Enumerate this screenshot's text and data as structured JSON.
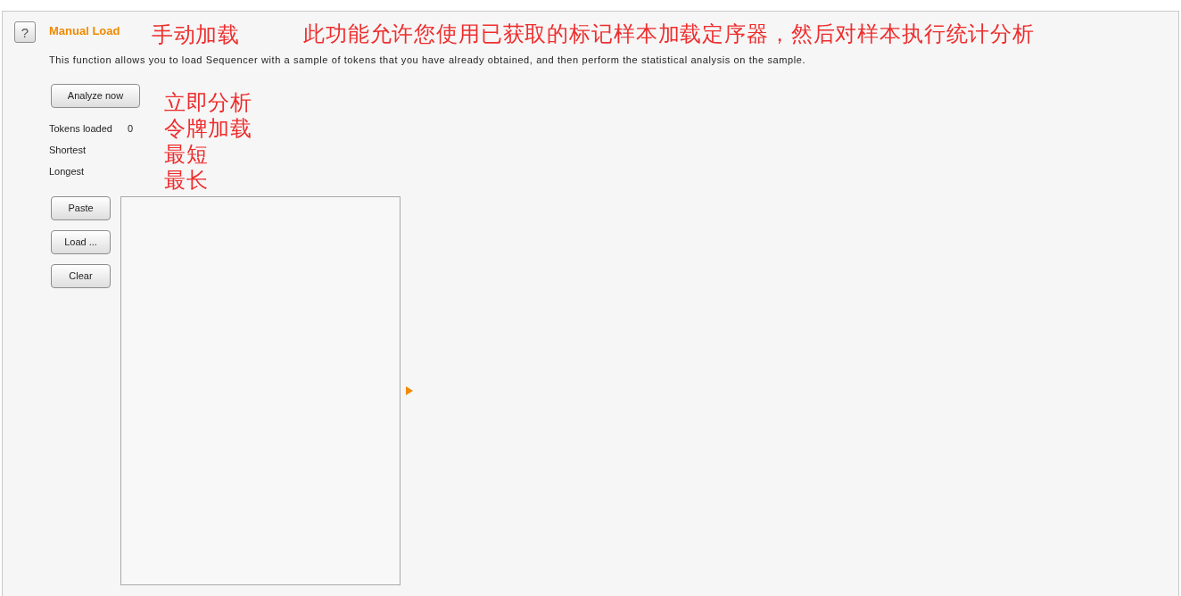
{
  "help_button": {
    "label": "?"
  },
  "header": {
    "title": "Manual Load",
    "title_note": "手动加载",
    "summary_note": "此功能允许您使用已获取的标记样本加载定序器，然后对样本执行统计分析",
    "description": "This function allows you to load Sequencer with a sample of tokens that you have already obtained, and then perform the statistical analysis on the sample."
  },
  "analyze_button": {
    "label": "Analyze now",
    "note": "立即分析"
  },
  "stats": [
    {
      "label": "Tokens loaded",
      "value": "0",
      "note": "令牌加载"
    },
    {
      "label": "Shortest",
      "note": "最短"
    },
    {
      "label": "Longest",
      "note": "最长"
    }
  ],
  "buttons": [
    {
      "label": "Paste"
    },
    {
      "label": "Load ..."
    },
    {
      "label": "Clear"
    }
  ]
}
